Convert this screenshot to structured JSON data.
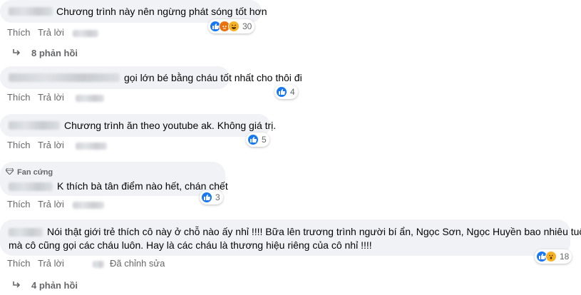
{
  "actions": {
    "like": "Thích",
    "reply": "Trả lời"
  },
  "comments": [
    {
      "text": "Chương trình này nên ngừng phát sóng tốt hơn",
      "reactions": [
        "like",
        "angry",
        "haha"
      ],
      "count": "30"
    },
    {
      "text": "gọi lớn bé bằng cháu tốt nhất cho thôi đi",
      "reactions": [
        "like"
      ],
      "count": "4"
    },
    {
      "text": "Chương trình ăn theo youtube ak. Không giá trị.",
      "reactions": [
        "like"
      ],
      "count": "5"
    },
    {
      "badge": "Fan cứng",
      "text": "K thích bà tân điểm nào hết, chán chết",
      "reactions": [
        "like"
      ],
      "count": "3"
    },
    {
      "text_line1": "Nói thật giới trẻ thích cô này ở chỗ nào ấy nhỉ !!!! Bữa lên trương trình người bí ẩn, Ngọc Sơn, Ngọc Huyền bao nhiêu tuổi",
      "text_line2": "mà cô cũng gọi các cháu luôn. Hay là các cháu là thương hiệu riêng của cô nhỉ !!!!",
      "reactions": [
        "like",
        "wow"
      ],
      "count": "18",
      "edited": "Đã chỉnh sửa"
    }
  ],
  "replies": [
    {
      "label": "8 phản hồi"
    },
    {
      "label": "4 phản hồi"
    }
  ]
}
